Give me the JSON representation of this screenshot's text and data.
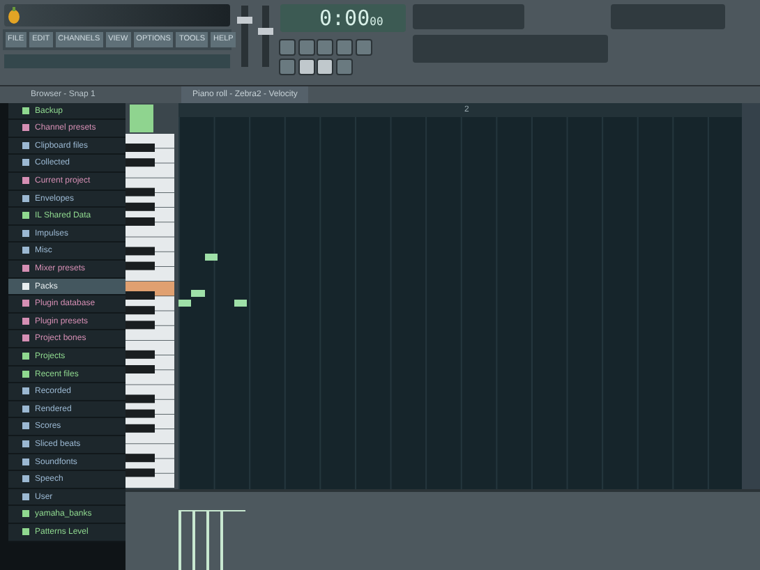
{
  "menu": [
    "FILE",
    "EDIT",
    "CHANNELS",
    "VIEW",
    "OPTIONS",
    "TOOLS",
    "HELP"
  ],
  "sliders": [
    {
      "level": 0.8
    },
    {
      "level": 0.6
    }
  ],
  "transport": [
    {
      "on": false
    },
    {
      "on": true
    },
    {
      "on": true
    },
    {
      "on": false
    }
  ],
  "time": {
    "main": "0:00",
    "small": "00"
  },
  "browser": {
    "title": "Browser - Snap 1",
    "items": [
      {
        "label": "Backup",
        "color": "#8fd88f",
        "selected": false
      },
      {
        "label": "Channel presets",
        "color": "#d58fb4",
        "selected": false
      },
      {
        "label": "Clipboard files",
        "color": "#9bb8d2",
        "selected": false
      },
      {
        "label": "Collected",
        "color": "#9bb8d2",
        "selected": false
      },
      {
        "label": "Current project",
        "color": "#d58fb4",
        "selected": false
      },
      {
        "label": "Envelopes",
        "color": "#9bb8d2",
        "selected": false
      },
      {
        "label": "IL Shared Data",
        "color": "#8fd88f",
        "selected": false
      },
      {
        "label": "Impulses",
        "color": "#9bb8d2",
        "selected": false
      },
      {
        "label": "Misc",
        "color": "#9bb8d2",
        "selected": false
      },
      {
        "label": "Mixer presets",
        "color": "#d58fb4",
        "selected": false
      },
      {
        "label": "Packs",
        "color": "#e8eef0",
        "selected": true
      },
      {
        "label": "Plugin database",
        "color": "#d58fb4",
        "selected": false
      },
      {
        "label": "Plugin presets",
        "color": "#d58fb4",
        "selected": false
      },
      {
        "label": "Project bones",
        "color": "#d58fb4",
        "selected": false
      },
      {
        "label": "Projects",
        "color": "#8fd88f",
        "selected": false
      },
      {
        "label": "Recent files",
        "color": "#8fd88f",
        "selected": false
      },
      {
        "label": "Recorded",
        "color": "#9bb8d2",
        "selected": false
      },
      {
        "label": "Rendered",
        "color": "#9bb8d2",
        "selected": false
      },
      {
        "label": "Scores",
        "color": "#9bb8d2",
        "selected": false
      },
      {
        "label": "Sliced beats",
        "color": "#9bb8d2",
        "selected": false
      },
      {
        "label": "Soundfonts",
        "color": "#9bb8d2",
        "selected": false
      },
      {
        "label": "Speech",
        "color": "#9bb8d2",
        "selected": false
      },
      {
        "label": "User",
        "color": "#9bb8d2",
        "selected": false
      },
      {
        "label": "yamaha_banks",
        "color": "#8fd88f",
        "selected": false
      },
      {
        "label": "Patterns Level",
        "color": "#8fd88f",
        "selected": false
      }
    ]
  },
  "piano_roll": {
    "title": "Piano roll - Zebra2 - Velocity",
    "bar_label": "2"
  }
}
